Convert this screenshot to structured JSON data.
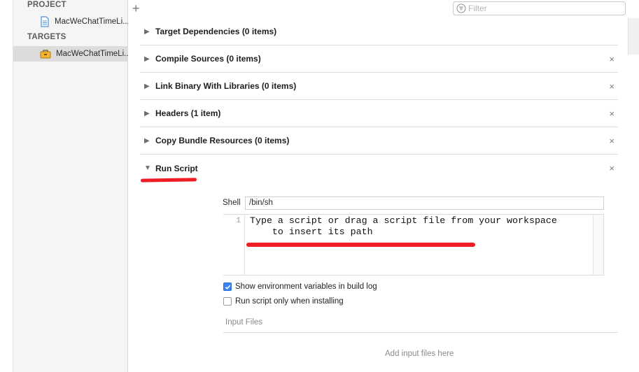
{
  "sidebar": {
    "project_header": "PROJECT",
    "project_item": "MacWeChatTimeLi...",
    "targets_header": "TARGETS",
    "target_item": "MacWeChatTimeLi..."
  },
  "toolbar": {
    "add_symbol": "+",
    "filter_placeholder": "Filter"
  },
  "phases": [
    {
      "label": "Target Dependencies (0 items)",
      "expanded": false,
      "removable": false
    },
    {
      "label": "Compile Sources (0 items)",
      "expanded": false,
      "removable": true
    },
    {
      "label": "Link Binary With Libraries (0 items)",
      "expanded": false,
      "removable": true
    },
    {
      "label": "Headers (1 item)",
      "expanded": false,
      "removable": true
    },
    {
      "label": "Copy Bundle Resources (0 items)",
      "expanded": false,
      "removable": true
    },
    {
      "label": "Run Script",
      "expanded": true,
      "removable": true
    }
  ],
  "close_symbol": "×",
  "run_script": {
    "shell_label": "Shell",
    "shell_value": "/bin/sh",
    "line_number": "1",
    "script_placeholder_line1": "Type a script or drag a script file from your workspace",
    "script_placeholder_line2": "    to insert its path",
    "show_env_label": "Show environment variables in build log",
    "show_env_checked": true,
    "only_installing_label": "Run script only when installing",
    "only_installing_checked": false,
    "input_files_label": "Input Files",
    "input_files_hint": "Add input files here"
  },
  "colors": {
    "annotation_red": "#ee1d23",
    "checkbox_blue": "#3b84f0"
  }
}
